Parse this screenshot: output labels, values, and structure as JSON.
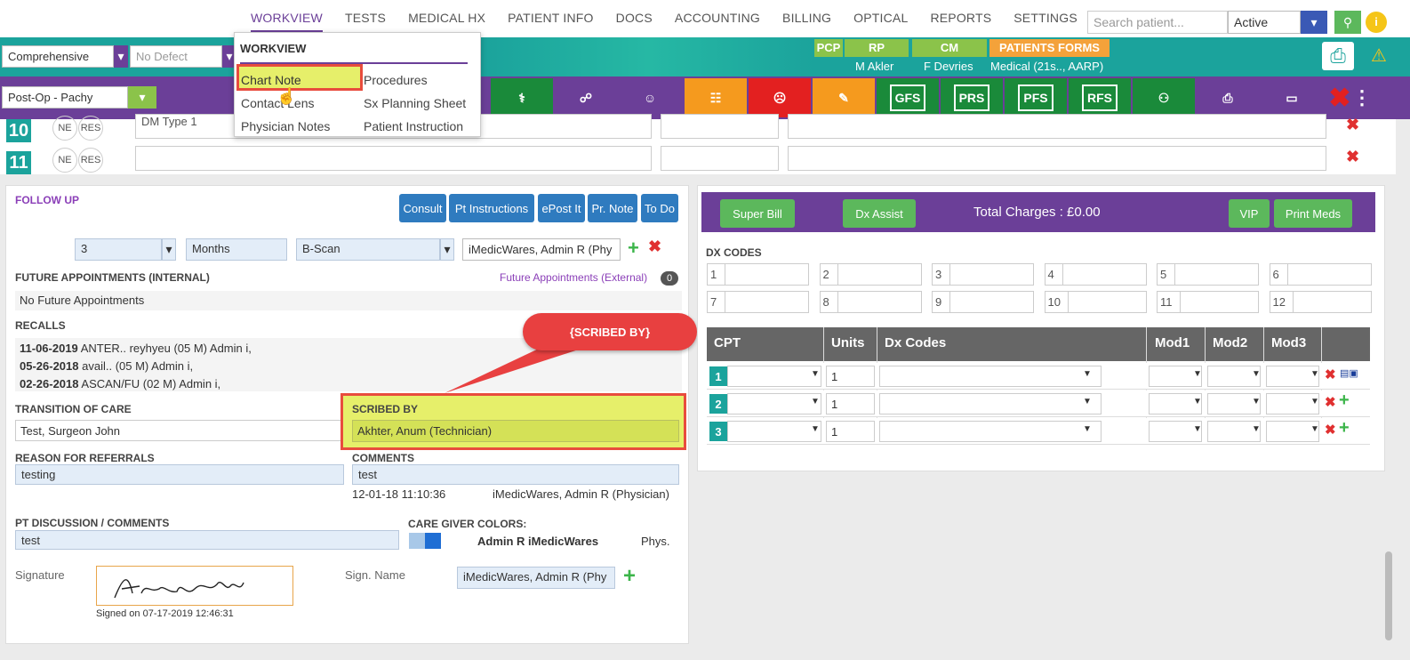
{
  "nav": {
    "items": [
      "WORKVIEW",
      "TESTS",
      "MEDICAL HX",
      "PATIENT INFO",
      "DOCS",
      "ACCOUNTING",
      "BILLING",
      "OPTICAL",
      "REPORTS",
      "SETTINGS"
    ]
  },
  "search": {
    "placeholder": "Search patient...",
    "status": "Active"
  },
  "toolbar": {
    "exam_type": "Comprehensive",
    "defect": "No Defect",
    "postop": "Post-Op - Pachy"
  },
  "providers": {
    "pcp": "PCP",
    "rp": "RP",
    "cm": "CM",
    "forms": "PATIENTS FORMS",
    "rp_name": "M Akler",
    "cm_name": "F Devries",
    "insurance": "Medical (21s.., AARP)"
  },
  "icons": {
    "gfs": "GFS",
    "prs": "PRS",
    "pfs": "PFS",
    "rfs": "RFS"
  },
  "menu": {
    "title": "WORKVIEW",
    "chart_note": "Chart Note",
    "procedures": "Procedures",
    "contact_lens": "Contact Lens",
    "sx_planning": "Sx Planning Sheet",
    "physician_notes": "Physician Notes",
    "patient_instruction": "Patient Instruction"
  },
  "rows": [
    {
      "num": "10",
      "ne": "NE",
      "res": "RES",
      "text": "DM Type 1"
    },
    {
      "num": "11",
      "ne": "NE",
      "res": "RES",
      "text": ""
    }
  ],
  "followup": {
    "title": "FOLLOW UP",
    "buttons": [
      "Consult",
      "Pt Instructions",
      "ePost It",
      "Pr. Note",
      "To Do"
    ],
    "num": "3",
    "unit": "Months",
    "test": "B-Scan",
    "provider": "iMedicWares, Admin R (Phy",
    "future_label": "FUTURE APPOINTMENTS (INTERNAL)",
    "future_ext": "Future Appointments (External)",
    "future_count": "0",
    "no_future": "No Future Appointments",
    "recalls_label": "RECALLS",
    "recalls": [
      {
        "date": "11-06-2019",
        "text": "ANTER.. reyhyeu (05 M) Admin i,"
      },
      {
        "date": "05-26-2018",
        "text": "avail.. (05 M) Admin i,"
      },
      {
        "date": "02-26-2018",
        "text": "ASCAN/FU (02 M) Admin i,"
      }
    ],
    "callout": "{SCRIBED BY}",
    "toc_label": "TRANSITION OF CARE",
    "toc_value": "Test, Surgeon John",
    "scribed_label": "SCRIBED BY",
    "scribed_value": "Akhter, Anum (Technician)",
    "referral_label": "REASON FOR REFERRALS",
    "referral_value": "testing",
    "comments_label": "COMMENTS",
    "comments_value": "test",
    "comments_date": "12-01-18 11:10:36",
    "comments_by": "iMedicWares, Admin R (Physician)",
    "disc_label": "PT DISCUSSION / COMMENTS",
    "disc_value": "test",
    "care_label": "CARE GIVER COLORS:",
    "care_name": "Admin R iMedicWares",
    "care_role": "Phys.",
    "sig_label": "Signature",
    "sig_name_label": "Sign. Name",
    "sig_name": "iMedicWares, Admin  R (Phy",
    "signed_on": "Signed on 07-17-2019 12:46:31"
  },
  "billing": {
    "super_bill": "Super Bill",
    "dx_assist": "Dx Assist",
    "total": "Total Charges : £0.00",
    "vip": "VIP",
    "print_meds": "Print Meds",
    "dx_label": "DX CODES",
    "dx_nums": [
      "1",
      "2",
      "3",
      "4",
      "5",
      "6",
      "7",
      "8",
      "9",
      "10",
      "11",
      "12"
    ],
    "cpt_headers": [
      "CPT",
      "Units",
      "Dx Codes",
      "Mod1",
      "Mod2",
      "Mod3"
    ],
    "cpt_rows": [
      {
        "num": "1",
        "units": "1"
      },
      {
        "num": "2",
        "units": "1"
      },
      {
        "num": "3",
        "units": "1"
      }
    ]
  }
}
